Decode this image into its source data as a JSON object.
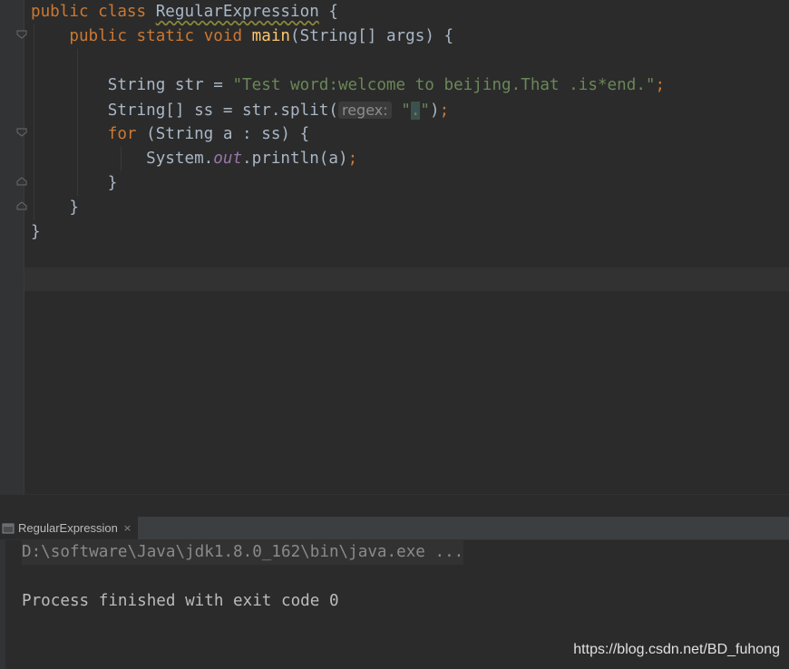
{
  "editor": {
    "lines": {
      "l1": {
        "kw1": "public",
        "kw2": "class",
        "classname": "RegularExpression",
        "brace": " {"
      },
      "l2": {
        "kw1": "public",
        "kw2": "static",
        "kw3": "void",
        "method": "main",
        "params": "(String[] args) {"
      },
      "l4": {
        "pre": "String str = ",
        "str": "\"Test word:welcome to beijing.That .is*end.\"",
        "semi": ";"
      },
      "l5": {
        "pre": "String[] ss = str.split(",
        "hint": "regex:",
        "q1": "\"",
        "dot": ".",
        "q2": "\"",
        "post": ")",
        "semi": ";"
      },
      "l6": {
        "kw": "for",
        "rest": " (String a : ss) {"
      },
      "l7": {
        "pre": "System.",
        "field": "out",
        "post": ".println(a)",
        "semi": ";"
      },
      "l8": {
        "text": "}"
      },
      "l9": {
        "text": "}"
      },
      "l10": {
        "text": "}"
      }
    }
  },
  "run_panel": {
    "tab_label": "RegularExpression",
    "tab_close": "×",
    "command": "D:\\software\\Java\\jdk1.8.0_162\\bin\\java.exe ...",
    "exit_message": "Process finished with exit code 0"
  },
  "watermark": "https://blog.csdn.net/BD_fuhong"
}
